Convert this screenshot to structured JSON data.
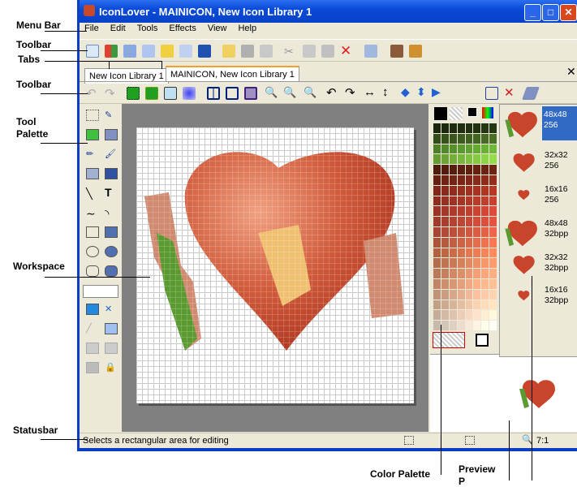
{
  "window": {
    "title": "IconLover - MAINICON, New Icon Library 1"
  },
  "menu": [
    "File",
    "Edit",
    "Tools",
    "Effects",
    "View",
    "Help"
  ],
  "tabs": [
    {
      "label": "New Icon Library 1",
      "active": false
    },
    {
      "label": "MAINICON, New Icon Library 1",
      "active": true
    }
  ],
  "icon_formats": [
    {
      "size": "48x48",
      "depth": "256",
      "selected": true
    },
    {
      "size": "32x32",
      "depth": "256",
      "selected": false
    },
    {
      "size": "16x16",
      "depth": "256",
      "selected": false
    },
    {
      "size": "48x48",
      "depth": "32bpp",
      "selected": false
    },
    {
      "size": "32x32",
      "depth": "32bpp",
      "selected": false
    },
    {
      "size": "16x16",
      "depth": "32bpp",
      "selected": false
    }
  ],
  "statusbar": {
    "text": "Selects a rectangular area for editing",
    "zoom": "7:1"
  },
  "annotations": {
    "menu_bar": "Menu Bar",
    "toolbar1": "Toolbar",
    "tabs": "Tabs",
    "toolbar2": "Toolbar",
    "tool_palette_1": "Tool",
    "tool_palette_2": "Palette",
    "workspace": "Workspace",
    "statusbar": "Statusbar",
    "color_palette": "Color Palette",
    "preview": "Preview",
    "preview_2": "P"
  },
  "colors": {
    "titlebar": "#0a4ad8",
    "selection": "#316ac5",
    "heart": "#c8442a"
  }
}
